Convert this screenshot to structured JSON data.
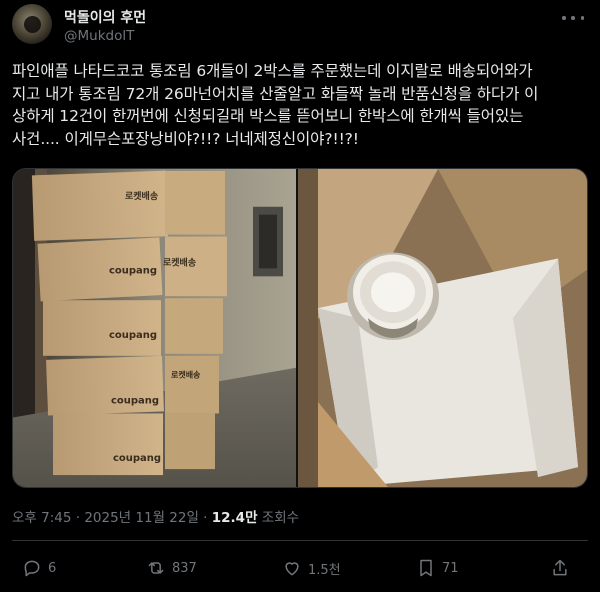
{
  "author": {
    "display_name": "먹돌이의 후먼",
    "handle": "@MukdolT"
  },
  "tweet": {
    "text": "파인애플 나타드코코 통조림 6개들이 2박스를 주문했는데 이지랄로 배송되어와가\n지고 내가 통조림 72개 26마넌어치를 산줄알고 화들짝 놀래 반품신청을 하다가 이\n상하게 12건이 한꺼번에 신청되길래 박스를 뜯어보니 한박스에 한개씩 들어있는\n사건.... 이게무슨포장낭비야?!!? 너네제정신이야?!!?!"
  },
  "media": {
    "box_labels": [
      "로켓배송",
      "coupang"
    ]
  },
  "meta": {
    "time": "오후 7:45",
    "separator": " · ",
    "date": "2025년 11월 22일",
    "views_count": "12.4만",
    "views_label": " 조회수"
  },
  "actions": {
    "replies": "6",
    "reposts": "837",
    "likes": "1.5천",
    "views": "71"
  },
  "icons": {
    "more": "more-icon",
    "reply": "reply-icon",
    "repost": "repost-icon",
    "like": "heart-icon",
    "bookmark": "bookmark-icon",
    "share": "share-icon"
  },
  "colors": {
    "background": "#000000",
    "text": "#e7e9ea",
    "muted": "#71767b",
    "border": "#2f3336"
  }
}
